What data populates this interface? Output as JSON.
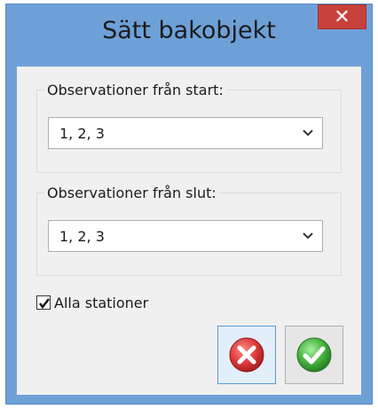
{
  "window": {
    "title": "Sätt bakobjekt",
    "close_glyph": "✕"
  },
  "groups": {
    "start": {
      "label": "Observationer från start:",
      "value": "1, 2, 3"
    },
    "end": {
      "label": "Observationer från slut:",
      "value": "1, 2, 3"
    }
  },
  "options": {
    "all_stations_label": "Alla stationer",
    "all_stations_checked": true
  },
  "icons": {
    "cancel": "red-circle-x-icon",
    "ok": "green-circle-check-icon"
  },
  "colors": {
    "title_bar": "#6ea0d8",
    "close_button": "#c9413b",
    "cancel_red": "#d93a3a",
    "ok_green": "#45b33e"
  }
}
